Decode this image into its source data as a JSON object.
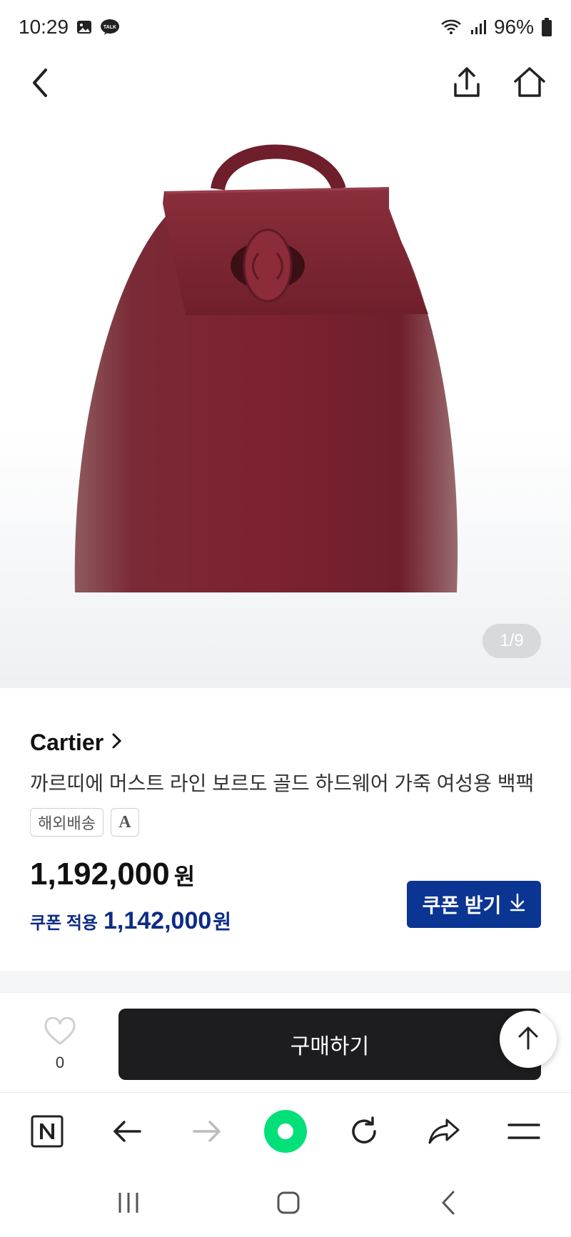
{
  "status_bar": {
    "time": "10:29",
    "battery": "96%",
    "talk_badge": "TALK"
  },
  "product": {
    "brand": "Cartier",
    "title": "까르띠에 머스트 라인 보르도 골드 하드웨어 가죽 여성용 백팩",
    "tags": [
      "해외배송",
      "A"
    ],
    "price": "1,192,000",
    "currency": "원",
    "coupon_label": "쿠폰 적용",
    "coupon_price": "1,142,000",
    "coupon_currency": "원",
    "coupon_button": "쿠폰 받기",
    "image_counter": "1/9",
    "image_current": 1,
    "image_total": 9,
    "bag_color": "#7d2230"
  },
  "buy_bar": {
    "wish_count": "0",
    "buy_label": "구매하기"
  },
  "colors": {
    "accent_blue": "#0b3593",
    "buy_button": "#1d1d1f",
    "naver_green": "#03e07a"
  },
  "icons": {
    "status": [
      "gallery-icon",
      "kakaotalk-icon",
      "wifi-icon",
      "signal-icon",
      "battery-icon"
    ],
    "top_nav": [
      "back-chevron-icon",
      "share-icon",
      "home-icon"
    ],
    "browser": [
      "naver-n-icon",
      "back-arrow-icon",
      "forward-arrow-icon",
      "green-dot-icon",
      "refresh-icon",
      "share-arrow-icon",
      "menu-icon"
    ],
    "system": [
      "recents-icon",
      "home-square-icon",
      "system-back-icon"
    ]
  }
}
